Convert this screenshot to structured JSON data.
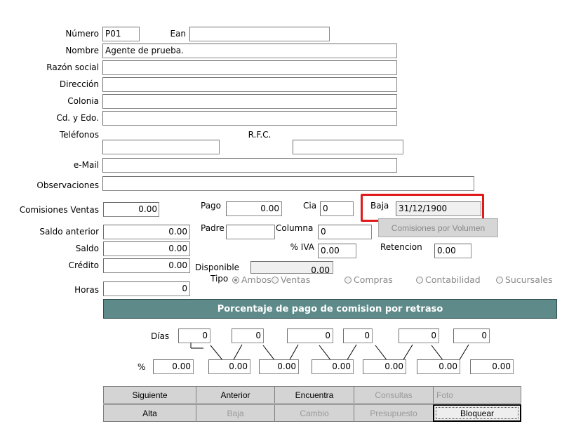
{
  "fields": {
    "numero": {
      "label": "Número",
      "value": "P01"
    },
    "ean": {
      "label": "Ean",
      "value": ""
    },
    "nombre": {
      "label": "Nombre",
      "value": "Agente de prueba."
    },
    "razon_social": {
      "label": "Razón social",
      "value": ""
    },
    "direccion": {
      "label": "Dirección",
      "value": ""
    },
    "colonia": {
      "label": "Colonia",
      "value": ""
    },
    "cd_edo": {
      "label": "Cd. y Edo.",
      "value": ""
    },
    "telefonos": {
      "label": "Teléfonos",
      "value": ""
    },
    "rfc": {
      "label": "R.F.C.",
      "value": ""
    },
    "email": {
      "label": "e-Mail",
      "value": ""
    },
    "observaciones": {
      "label": "Observaciones",
      "value": ""
    },
    "comisiones_ventas": {
      "label": "Comisiones Ventas",
      "value": "0.00"
    },
    "pago": {
      "label": "Pago",
      "value": "0.00"
    },
    "cia": {
      "label": "Cia",
      "value": "0"
    },
    "baja": {
      "label": "Baja",
      "value": "31/12/1900"
    },
    "saldo_anterior": {
      "label": "Saldo anterior",
      "value": "0.00"
    },
    "padre": {
      "label": "Padre",
      "value": ""
    },
    "columna": {
      "label": "Columna",
      "value": "0"
    },
    "saldo": {
      "label": "Saldo",
      "value": "0.00"
    },
    "iva": {
      "label": "% IVA",
      "value": "0.00"
    },
    "retencion": {
      "label": "Retencion",
      "value": "0.00"
    },
    "credito": {
      "label": "Crédito",
      "value": "0.00"
    },
    "disponible": {
      "label": "Disponible",
      "value": "0.00"
    },
    "horas": {
      "label": "Horas",
      "value": "0"
    }
  },
  "comisiones_volumen_button": "Comisiones por Volumen",
  "tipo": {
    "label": "Tipo",
    "options": [
      "Ambos",
      "Ventas",
      "Compras",
      "Contabilidad",
      "Sucursales"
    ],
    "selected": "Ambos"
  },
  "retraso": {
    "title": "Porcentaje de pago de comision por retraso",
    "dias_label": "Días",
    "pct_label": "%",
    "dias": [
      "0",
      "0",
      "0",
      "0",
      "0",
      "0"
    ],
    "pct": [
      "0.00",
      "0.00",
      "0.00",
      "0.00",
      "0.00",
      "0.00",
      "0.00"
    ]
  },
  "buttons": {
    "row1": [
      "Siguiente",
      "Anterior",
      "Encuentra",
      "Consultas",
      "Foto"
    ],
    "row2": [
      "Alta",
      "Baja",
      "Cambio",
      "Presupuesto",
      "Bloquear"
    ]
  }
}
